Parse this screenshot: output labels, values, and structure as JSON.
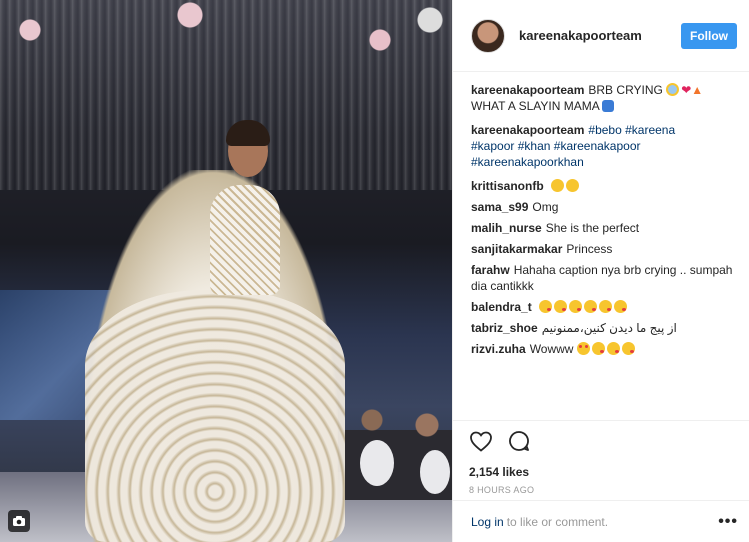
{
  "header": {
    "username": "kareenakapoorteam",
    "follow_label": "Follow"
  },
  "caption": {
    "username": "kareenakapoorteam",
    "text": "BRB CRYING",
    "text2": "WHAT A SLAYIN MAMA"
  },
  "hashtags": {
    "username": "kareenakapoorteam",
    "tags": [
      "#bebo",
      "#kareena",
      "#kapoor",
      "#khan",
      "#kareenakapoor",
      "#kareenakapoorkhan"
    ]
  },
  "comments": [
    {
      "user": "krittisanonfb",
      "text": ""
    },
    {
      "user": "sama_s99",
      "text": "Omg"
    },
    {
      "user": "malih_nurse",
      "text": "She is the perfect"
    },
    {
      "user": "sanjitakarmakar",
      "text": "Princess"
    },
    {
      "user": "farahw",
      "text": "Hahaha caption nya brb crying .. sumpah dia cantikkk"
    },
    {
      "user": "balendra_t",
      "text": ""
    },
    {
      "user": "tabriz_shoe",
      "text": "از پیج ما دیدن کنین،ممنونیم"
    },
    {
      "user": "rizvi.zuha",
      "text": "Wowww"
    }
  ],
  "actions": {
    "likes": "2,154 likes",
    "time": "8 HOURS AGO"
  },
  "footer": {
    "login": "Log in",
    "rest": "to like or comment.",
    "more": "•••"
  },
  "icons": {
    "like": "heart-outline-icon",
    "comment": "comment-bubble-icon",
    "video": "video-camera-icon"
  },
  "colors": {
    "follow_button": "#3897f0",
    "link": "#003569",
    "muted": "#999999"
  }
}
